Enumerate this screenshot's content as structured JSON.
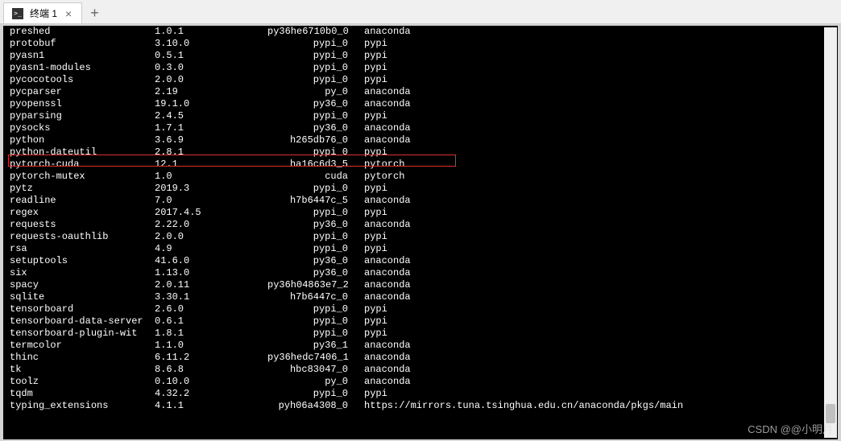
{
  "tab": {
    "title": "终端 1"
  },
  "highlight_row_index": 10,
  "packages": [
    {
      "name": "preshed",
      "version": "1.0.1",
      "build": "py36he6710b0_0",
      "channel": "anaconda"
    },
    {
      "name": "protobuf",
      "version": "3.10.0",
      "build": "pypi_0",
      "channel": "pypi"
    },
    {
      "name": "pyasn1",
      "version": "0.5.1",
      "build": "pypi_0",
      "channel": "pypi"
    },
    {
      "name": "pyasn1-modules",
      "version": "0.3.0",
      "build": "pypi_0",
      "channel": "pypi"
    },
    {
      "name": "pycocotools",
      "version": "2.0.0",
      "build": "pypi_0",
      "channel": "pypi"
    },
    {
      "name": "pycparser",
      "version": "2.19",
      "build": "py_0",
      "channel": "anaconda"
    },
    {
      "name": "pyopenssl",
      "version": "19.1.0",
      "build": "py36_0",
      "channel": "anaconda"
    },
    {
      "name": "pyparsing",
      "version": "2.4.5",
      "build": "pypi_0",
      "channel": "pypi"
    },
    {
      "name": "pysocks",
      "version": "1.7.1",
      "build": "py36_0",
      "channel": "anaconda"
    },
    {
      "name": "python",
      "version": "3.6.9",
      "build": "h265db76_0",
      "channel": "anaconda"
    },
    {
      "name": "python-dateutil",
      "version": "2.8.1",
      "build": "pypi_0",
      "channel": "pypi"
    },
    {
      "name": "pytorch-cuda",
      "version": "12.1",
      "build": "ha16c6d3_5",
      "channel": "pytorch"
    },
    {
      "name": "pytorch-mutex",
      "version": "1.0",
      "build": "cuda",
      "channel": "pytorch"
    },
    {
      "name": "pytz",
      "version": "2019.3",
      "build": "pypi_0",
      "channel": "pypi"
    },
    {
      "name": "readline",
      "version": "7.0",
      "build": "h7b6447c_5",
      "channel": "anaconda"
    },
    {
      "name": "regex",
      "version": "2017.4.5",
      "build": "pypi_0",
      "channel": "pypi"
    },
    {
      "name": "requests",
      "version": "2.22.0",
      "build": "py36_0",
      "channel": "anaconda"
    },
    {
      "name": "requests-oauthlib",
      "version": "2.0.0",
      "build": "pypi_0",
      "channel": "pypi"
    },
    {
      "name": "rsa",
      "version": "4.9",
      "build": "pypi_0",
      "channel": "pypi"
    },
    {
      "name": "setuptools",
      "version": "41.6.0",
      "build": "py36_0",
      "channel": "anaconda"
    },
    {
      "name": "six",
      "version": "1.13.0",
      "build": "py36_0",
      "channel": "anaconda"
    },
    {
      "name": "spacy",
      "version": "2.0.11",
      "build": "py36h04863e7_2",
      "channel": "anaconda"
    },
    {
      "name": "sqlite",
      "version": "3.30.1",
      "build": "h7b6447c_0",
      "channel": "anaconda"
    },
    {
      "name": "tensorboard",
      "version": "2.6.0",
      "build": "pypi_0",
      "channel": "pypi"
    },
    {
      "name": "tensorboard-data-server",
      "version": "0.6.1",
      "build": "pypi_0",
      "channel": "pypi"
    },
    {
      "name": "tensorboard-plugin-wit",
      "version": "1.8.1",
      "build": "pypi_0",
      "channel": "pypi"
    },
    {
      "name": "termcolor",
      "version": "1.1.0",
      "build": "py36_1",
      "channel": "anaconda"
    },
    {
      "name": "thinc",
      "version": "6.11.2",
      "build": "py36hedc7406_1",
      "channel": "anaconda"
    },
    {
      "name": "tk",
      "version": "8.6.8",
      "build": "hbc83047_0",
      "channel": "anaconda"
    },
    {
      "name": "toolz",
      "version": "0.10.0",
      "build": "py_0",
      "channel": "anaconda"
    },
    {
      "name": "tqdm",
      "version": "4.32.2",
      "build": "pypi_0",
      "channel": "pypi"
    },
    {
      "name": "typing_extensions",
      "version": "4.1.1",
      "build": "pyh06a4308_0",
      "channel": "https://mirrors.tuna.tsinghua.edu.cn/anaconda/pkgs/main"
    }
  ],
  "watermark": "CSDN @@小明月"
}
